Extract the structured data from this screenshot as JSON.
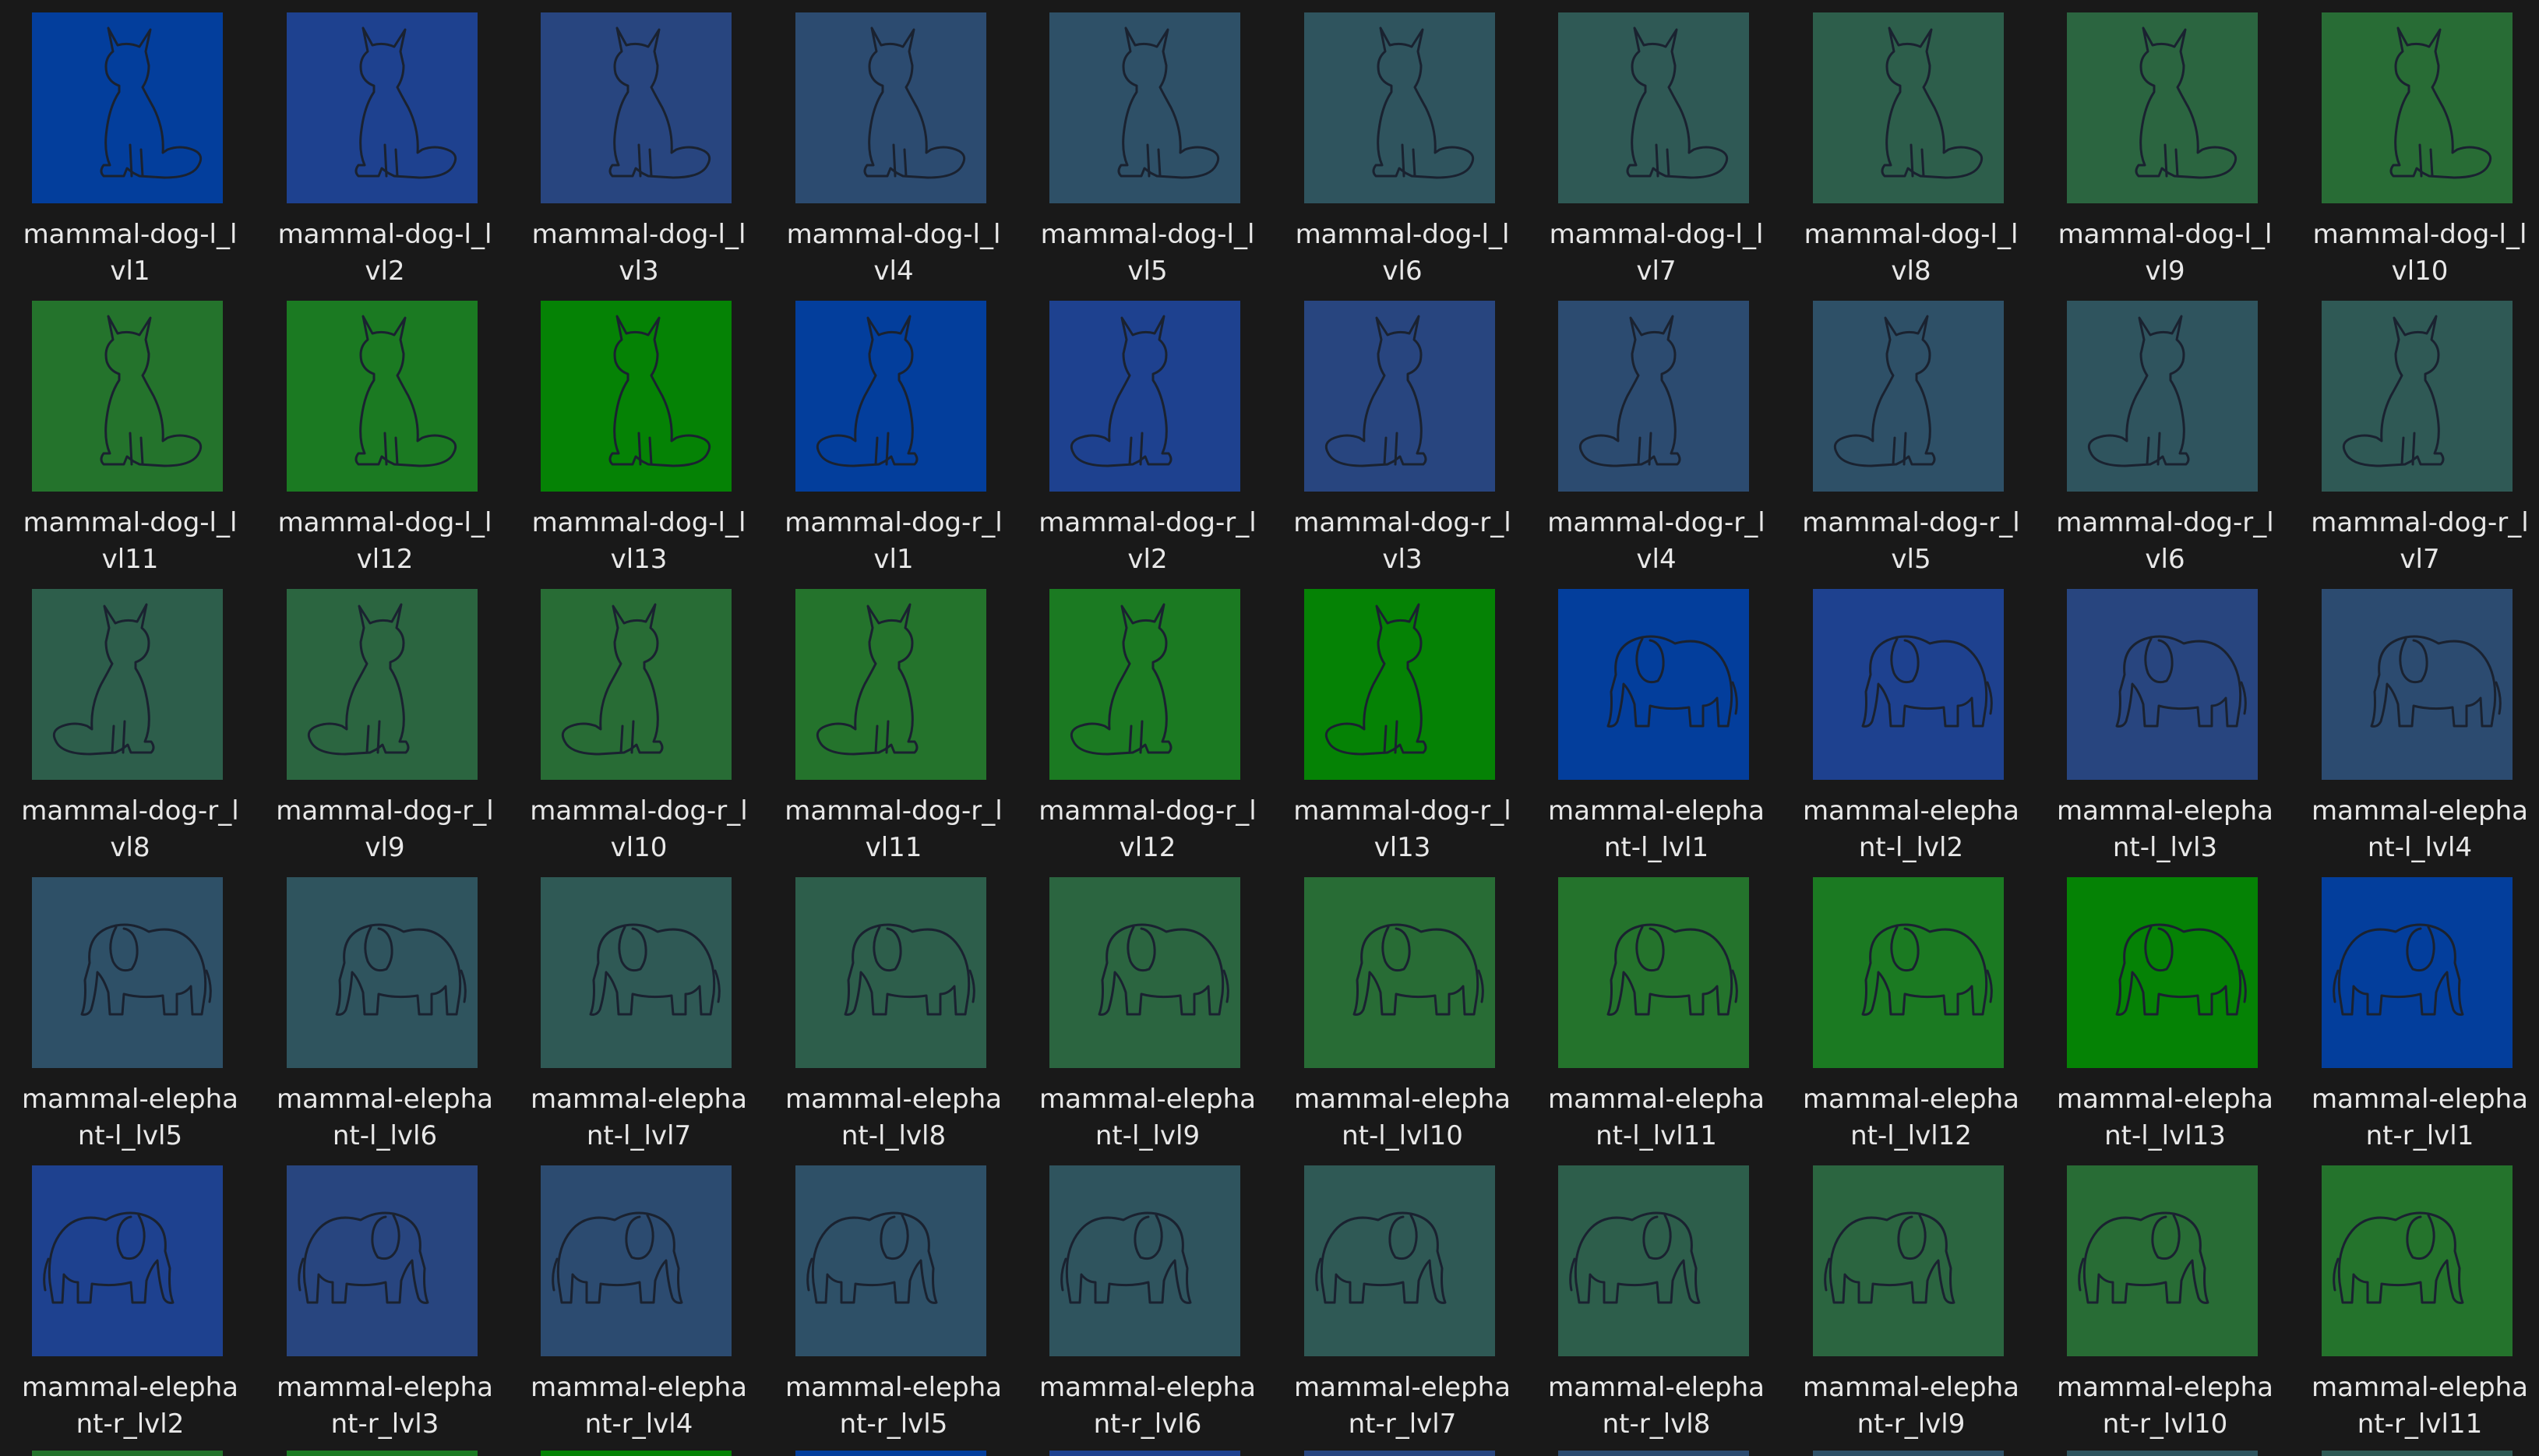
{
  "tiles": [
    {
      "name": "mammal-dog-l_lvl1",
      "line1": "mammal-dog-l_l",
      "line2": "vl1",
      "icon": "dog-l-icon",
      "color": "#033e9c"
    },
    {
      "name": "mammal-dog-l_lvl2",
      "line1": "mammal-dog-l_l",
      "line2": "vl2",
      "icon": "dog-l-icon",
      "color": "#1e418f"
    },
    {
      "name": "mammal-dog-l_lvl3",
      "line1": "mammal-dog-l_l",
      "line2": "vl3",
      "icon": "dog-l-icon",
      "color": "#28457f"
    },
    {
      "name": "mammal-dog-l_lvl4",
      "line1": "mammal-dog-l_l",
      "line2": "vl4",
      "icon": "dog-l-icon",
      "color": "#2c4b70"
    },
    {
      "name": "mammal-dog-l_lvl5",
      "line1": "mammal-dog-l_l",
      "line2": "vl5",
      "icon": "dog-l-icon",
      "color": "#2e5067"
    },
    {
      "name": "mammal-dog-l_lvl6",
      "line1": "mammal-dog-l_l",
      "line2": "vl6",
      "icon": "dog-l-icon",
      "color": "#2f545e"
    },
    {
      "name": "mammal-dog-l_lvl7",
      "line1": "mammal-dog-l_l",
      "line2": "vl7",
      "icon": "dog-l-icon",
      "color": "#2f5955"
    },
    {
      "name": "mammal-dog-l_lvl8",
      "line1": "mammal-dog-l_l",
      "line2": "vl8",
      "icon": "dog-l-icon",
      "color": "#2d5e4b"
    },
    {
      "name": "mammal-dog-l_lvl9",
      "line1": "mammal-dog-l_l",
      "line2": "vl9",
      "icon": "dog-l-icon",
      "color": "#2b6540"
    },
    {
      "name": "mammal-dog-l_lvl10",
      "line1": "mammal-dog-l_l",
      "line2": "vl10",
      "icon": "dog-l-icon",
      "color": "#286c35"
    },
    {
      "name": "mammal-dog-l_lvl11",
      "line1": "mammal-dog-l_l",
      "line2": "vl11",
      "icon": "dog-l-icon",
      "color": "#24732c"
    },
    {
      "name": "mammal-dog-l_lvl12",
      "line1": "mammal-dog-l_l",
      "line2": "vl12",
      "icon": "dog-l-icon",
      "color": "#1b7a22"
    },
    {
      "name": "mammal-dog-l_lvl13",
      "line1": "mammal-dog-l_l",
      "line2": "vl13",
      "icon": "dog-l-icon",
      "color": "#058205"
    },
    {
      "name": "mammal-dog-r_lvl1",
      "line1": "mammal-dog-r_l",
      "line2": "vl1",
      "icon": "dog-r-icon",
      "color": "#033e9c"
    },
    {
      "name": "mammal-dog-r_lvl2",
      "line1": "mammal-dog-r_l",
      "line2": "vl2",
      "icon": "dog-r-icon",
      "color": "#1e418f"
    },
    {
      "name": "mammal-dog-r_lvl3",
      "line1": "mammal-dog-r_l",
      "line2": "vl3",
      "icon": "dog-r-icon",
      "color": "#28457f"
    },
    {
      "name": "mammal-dog-r_lvl4",
      "line1": "mammal-dog-r_l",
      "line2": "vl4",
      "icon": "dog-r-icon",
      "color": "#2c4b70"
    },
    {
      "name": "mammal-dog-r_lvl5",
      "line1": "mammal-dog-r_l",
      "line2": "vl5",
      "icon": "dog-r-icon",
      "color": "#2e5067"
    },
    {
      "name": "mammal-dog-r_lvl6",
      "line1": "mammal-dog-r_l",
      "line2": "vl6",
      "icon": "dog-r-icon",
      "color": "#2f545e"
    },
    {
      "name": "mammal-dog-r_lvl7",
      "line1": "mammal-dog-r_l",
      "line2": "vl7",
      "icon": "dog-r-icon",
      "color": "#2f5955"
    },
    {
      "name": "mammal-dog-r_lvl8",
      "line1": "mammal-dog-r_l",
      "line2": "vl8",
      "icon": "dog-r-icon",
      "color": "#2d5e4b"
    },
    {
      "name": "mammal-dog-r_lvl9",
      "line1": "mammal-dog-r_l",
      "line2": "vl9",
      "icon": "dog-r-icon",
      "color": "#2b6540"
    },
    {
      "name": "mammal-dog-r_lvl10",
      "line1": "mammal-dog-r_l",
      "line2": "vl10",
      "icon": "dog-r-icon",
      "color": "#286c35"
    },
    {
      "name": "mammal-dog-r_lvl11",
      "line1": "mammal-dog-r_l",
      "line2": "vl11",
      "icon": "dog-r-icon",
      "color": "#24732c"
    },
    {
      "name": "mammal-dog-r_lvl12",
      "line1": "mammal-dog-r_l",
      "line2": "vl12",
      "icon": "dog-r-icon",
      "color": "#1b7a22"
    },
    {
      "name": "mammal-dog-r_lvl13",
      "line1": "mammal-dog-r_l",
      "line2": "vl13",
      "icon": "dog-r-icon",
      "color": "#058205"
    },
    {
      "name": "mammal-elephant-l_lvl1",
      "line1": "mammal-elepha",
      "line2": "nt-l_lvl1",
      "icon": "elephant-l-icon",
      "color": "#033e9c"
    },
    {
      "name": "mammal-elephant-l_lvl2",
      "line1": "mammal-elepha",
      "line2": "nt-l_lvl2",
      "icon": "elephant-l-icon",
      "color": "#1e418f"
    },
    {
      "name": "mammal-elephant-l_lvl3",
      "line1": "mammal-elepha",
      "line2": "nt-l_lvl3",
      "icon": "elephant-l-icon",
      "color": "#28457f"
    },
    {
      "name": "mammal-elephant-l_lvl4",
      "line1": "mammal-elepha",
      "line2": "nt-l_lvl4",
      "icon": "elephant-l-icon",
      "color": "#2c4b70"
    },
    {
      "name": "mammal-elephant-l_lvl5",
      "line1": "mammal-elepha",
      "line2": "nt-l_lvl5",
      "icon": "elephant-l-icon",
      "color": "#2e5067"
    },
    {
      "name": "mammal-elephant-l_lvl6",
      "line1": "mammal-elepha",
      "line2": "nt-l_lvl6",
      "icon": "elephant-l-icon",
      "color": "#2f545e"
    },
    {
      "name": "mammal-elephant-l_lvl7",
      "line1": "mammal-elepha",
      "line2": "nt-l_lvl7",
      "icon": "elephant-l-icon",
      "color": "#2f5955"
    },
    {
      "name": "mammal-elephant-l_lvl8",
      "line1": "mammal-elepha",
      "line2": "nt-l_lvl8",
      "icon": "elephant-l-icon",
      "color": "#2d5e4b"
    },
    {
      "name": "mammal-elephant-l_lvl9",
      "line1": "mammal-elepha",
      "line2": "nt-l_lvl9",
      "icon": "elephant-l-icon",
      "color": "#2b6540"
    },
    {
      "name": "mammal-elephant-l_lvl10",
      "line1": "mammal-elepha",
      "line2": "nt-l_lvl10",
      "icon": "elephant-l-icon",
      "color": "#286c35"
    },
    {
      "name": "mammal-elephant-l_lvl11",
      "line1": "mammal-elepha",
      "line2": "nt-l_lvl11",
      "icon": "elephant-l-icon",
      "color": "#24732c"
    },
    {
      "name": "mammal-elephant-l_lvl12",
      "line1": "mammal-elepha",
      "line2": "nt-l_lvl12",
      "icon": "elephant-l-icon",
      "color": "#1b7a22"
    },
    {
      "name": "mammal-elephant-l_lvl13",
      "line1": "mammal-elepha",
      "line2": "nt-l_lvl13",
      "icon": "elephant-l-icon",
      "color": "#058205"
    },
    {
      "name": "mammal-elephant-r_lvl1",
      "line1": "mammal-elepha",
      "line2": "nt-r_lvl1",
      "icon": "elephant-r-icon",
      "color": "#033e9c"
    },
    {
      "name": "mammal-elephant-r_lvl2",
      "line1": "mammal-elepha",
      "line2": "nt-r_lvl2",
      "icon": "elephant-r-icon",
      "color": "#1e418f"
    },
    {
      "name": "mammal-elephant-r_lvl3",
      "line1": "mammal-elepha",
      "line2": "nt-r_lvl3",
      "icon": "elephant-r-icon",
      "color": "#28457f"
    },
    {
      "name": "mammal-elephant-r_lvl4",
      "line1": "mammal-elepha",
      "line2": "nt-r_lvl4",
      "icon": "elephant-r-icon",
      "color": "#2c4b70"
    },
    {
      "name": "mammal-elephant-r_lvl5",
      "line1": "mammal-elepha",
      "line2": "nt-r_lvl5",
      "icon": "elephant-r-icon",
      "color": "#2e5067"
    },
    {
      "name": "mammal-elephant-r_lvl6",
      "line1": "mammal-elepha",
      "line2": "nt-r_lvl6",
      "icon": "elephant-r-icon",
      "color": "#2f545e"
    },
    {
      "name": "mammal-elephant-r_lvl7",
      "line1": "mammal-elepha",
      "line2": "nt-r_lvl7",
      "icon": "elephant-r-icon",
      "color": "#2f5955"
    },
    {
      "name": "mammal-elephant-r_lvl8",
      "line1": "mammal-elepha",
      "line2": "nt-r_lvl8",
      "icon": "elephant-r-icon",
      "color": "#2d5e4b"
    },
    {
      "name": "mammal-elephant-r_lvl9",
      "line1": "mammal-elepha",
      "line2": "nt-r_lvl9",
      "icon": "elephant-r-icon",
      "color": "#2b6540"
    },
    {
      "name": "mammal-elephant-r_lvl10",
      "line1": "mammal-elepha",
      "line2": "nt-r_lvl10",
      "icon": "elephant-r-icon",
      "color": "#286c35"
    },
    {
      "name": "mammal-elephant-r_lvl11",
      "line1": "mammal-elepha",
      "line2": "nt-r_lvl11",
      "icon": "elephant-r-icon",
      "color": "#24732c"
    }
  ],
  "peek_row_colors": [
    "#24732c",
    "#1b7a22",
    "#058205",
    "#033e9c",
    "#1e418f",
    "#28457f",
    "#2c4b70",
    "#2e5067",
    "#2f545e",
    "#2f5955"
  ],
  "line_color": "#1a2230"
}
